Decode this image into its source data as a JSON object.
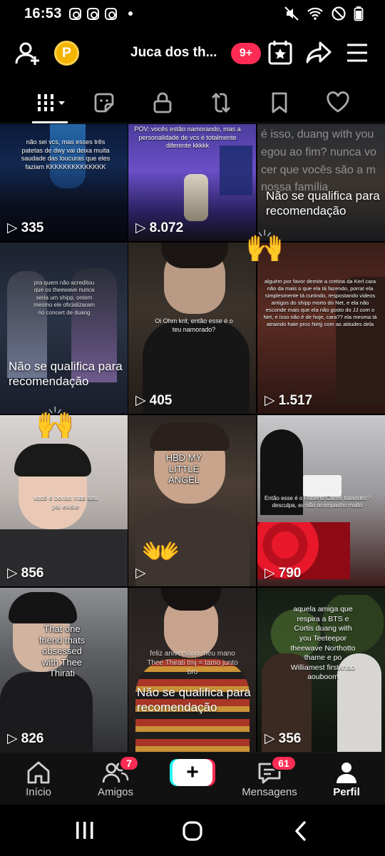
{
  "status_bar": {
    "time": "16:53"
  },
  "header": {
    "username": "Juca dos th...",
    "notifications_badge": "9+",
    "coin_label": "P"
  },
  "tabs": [
    "videos",
    "favorites",
    "private",
    "reposts",
    "saved",
    "liked"
  ],
  "videos": [
    {
      "views": "335",
      "caption": "não sei vcs, mas esses três patetas de dwy vai deixa muita saudade das loucuras que eles faziam KKKKKKKKKKKKKK"
    },
    {
      "views": "8.072",
      "caption": "POV: vocês estão namorando, mas a personalidade de vcs é totalmente diferente kkkkk"
    },
    {
      "views": "",
      "caption": "é isso, duang with you egou ao fim? nunca vo cer que vocês são a m nossa família",
      "overlay": "Não se qualifica para recomendação"
    },
    {
      "views": "",
      "caption": "pra quem não acreditou que os theewave nunca seria um shipp, ontem mesmo ele oficializaram no concert de duang",
      "overlay": "Não se qualifica para recomendação"
    },
    {
      "views": "405",
      "caption": "Oi Ohm krit, então esse é o teu namorado?"
    },
    {
      "views": "1.517",
      "caption": "alguém por favor demite a cretina da Kerl cara não da mais o que ela tá fazendo, porra! ela simplesmente tá curtindo, respostando videos antigos do shipp morto do Net, e ela não esconde mais que ela não gosto do JJ com o Net, e isso não é de hoje, cara?? ela mesma tá atraindo hate pros Netjj com as atitudes dela"
    },
    {
      "views": "856",
      "caption": "você é bonito mas seu pai existe"
    },
    {
      "views": "",
      "caption": "HBD MY LITTLE ANGEL"
    },
    {
      "views": "790",
      "caption": "Então esse é o Roberto Carlos tailandês? desculpa, eu não acompanho muito"
    },
    {
      "views": "826",
      "caption": "That one friend thats obsessed with Thee Thirati"
    },
    {
      "views": "",
      "caption": "feliz aniversário meu mano Thee Thirati tmj = tamo junto bro",
      "overlay": "Não se qualifica para recomendação"
    },
    {
      "views": "356",
      "caption": "aquela amiga que respira a BTS e Cortis duang with you Teeteepor theewave Northotto thame e po Williamest firstkhao aouboom"
    }
  ],
  "bottom_nav": {
    "home": "Início",
    "friends": "Amigos",
    "friends_badge": "7",
    "messages": "Mensagens",
    "messages_badge": "61",
    "profile": "Perfil"
  },
  "colors": {
    "accent": "#fe2c55",
    "coin": "#f5b400",
    "cyan": "#25f4ee"
  }
}
